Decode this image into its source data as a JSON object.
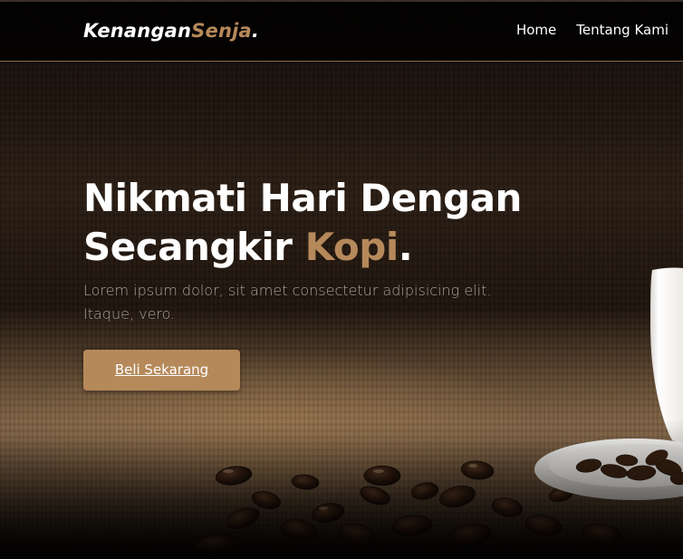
{
  "navbar": {
    "logo_primary": "Kenangan",
    "logo_accent": "Senja",
    "logo_dot": ".",
    "links": [
      "Home",
      "Tentang Kami"
    ]
  },
  "hero": {
    "headline_line1": "Nikmati Hari Dengan",
    "headline_line2_prefix": "Secangkir ",
    "headline_accent": "Kopi",
    "headline_dot": ".",
    "subtext": "Lorem ipsum dolor, sit amet consectetur adipisicing elit. Itaque, vero.",
    "cta_label": "Beli Sekarang"
  },
  "colors": {
    "accent": "#b6895b",
    "navbar_bg": "#000000",
    "text": "#ffffff"
  },
  "icons": {
    "background": "coffee-beans-and-cup-photo"
  }
}
